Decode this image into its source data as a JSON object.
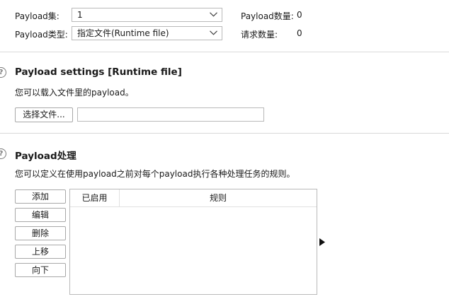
{
  "top": {
    "payload_set_label": "Payload集:",
    "payload_set_value": "1",
    "payload_type_label": "Payload类型:",
    "payload_type_value": "指定文件(Runtime file)",
    "payload_count_label": "Payload数量:",
    "payload_count_value": "0",
    "request_count_label": "请求数量:",
    "request_count_value": "0"
  },
  "settings": {
    "title": "Payload settings [Runtime file]",
    "description": "您可以载入文件里的payload。",
    "choose_file_label": "选择文件...",
    "file_path_value": ""
  },
  "processing": {
    "title": "Payload处理",
    "description": "您可以定义在使用payload之前对每个payload执行各种处理任务的规则。",
    "buttons": {
      "add": "添加",
      "edit": "编辑",
      "remove": "删除",
      "up": "上移",
      "down": "向下"
    },
    "table": {
      "columns": [
        "已启用",
        "规则"
      ],
      "rows": []
    }
  },
  "icons": {
    "help": "help-icon",
    "dropdown": "chevron-down-icon",
    "expand": "play-arrow-icon"
  }
}
